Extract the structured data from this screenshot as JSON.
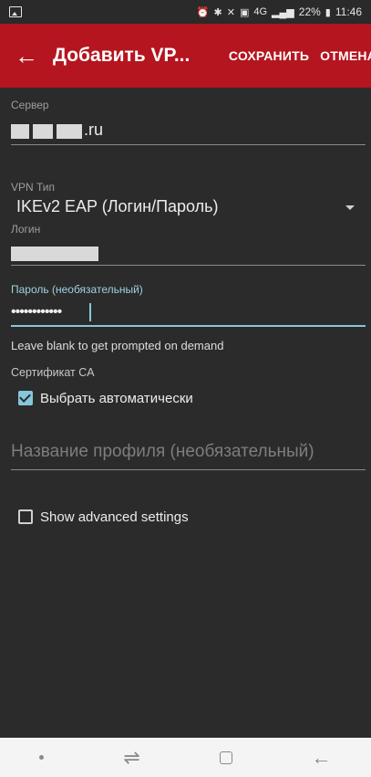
{
  "status_bar": {
    "battery": "22%",
    "time": "11:46",
    "network": "4G"
  },
  "app_bar": {
    "title": "Добавить VP...",
    "save_label": "СОХРАНИТЬ",
    "cancel_label": "ОТМЕНА",
    "color": "#b5151f"
  },
  "form": {
    "server": {
      "label": "Сервер",
      "value_suffix": ".ru"
    },
    "vpn_type": {
      "label": "VPN Тип",
      "value": "IKEv2 EAP (Логин/Пароль)"
    },
    "login": {
      "label": "Логин"
    },
    "password": {
      "label": "Пароль (необязательный)",
      "value": "••••••••••••",
      "hint": "Leave blank to get prompted on demand"
    },
    "ca_cert": {
      "label": "Сертификат CA",
      "auto_label": "Выбрать автоматически",
      "checked": true
    },
    "profile_name": {
      "placeholder": "Название профиля (необязательный)"
    },
    "advanced": {
      "label": "Show advanced settings",
      "checked": false
    }
  },
  "accent_color": "#86c7dc"
}
